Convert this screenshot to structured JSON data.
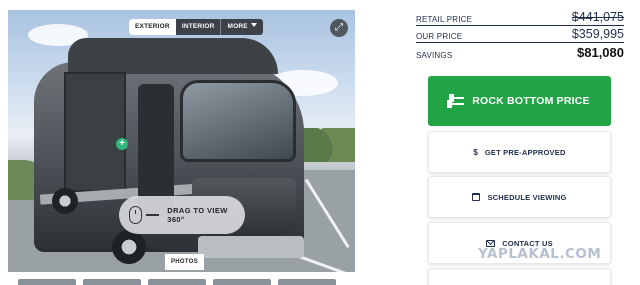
{
  "gallery": {
    "tabs": [
      {
        "label": "EXTERIOR",
        "active": true
      },
      {
        "label": "INTERIOR",
        "active": false
      },
      {
        "label": "MORE",
        "active": false
      }
    ],
    "drag_hint": "DRAG TO VIEW 360°",
    "photos_label": "PHOTOS",
    "expand_icon": "expand-icon",
    "hotspot_icon": "plus-icon"
  },
  "pricing": {
    "retail_label": "RETAIL PRICE",
    "retail_value": "$441,075",
    "our_label": "OUR PRICE",
    "our_value": "$359,995",
    "savings_label": "SAVINGS",
    "savings_value": "$81,080"
  },
  "actions": {
    "primary_label": "ROCK BOTTOM PRICE",
    "primary_color": "#20a445",
    "preapproved_label": "GET PRE-APPROVED",
    "schedule_label": "SCHEDULE VIEWING",
    "contact_label": "CONTACT US"
  },
  "watermark": "YAPLAKAL.COM"
}
